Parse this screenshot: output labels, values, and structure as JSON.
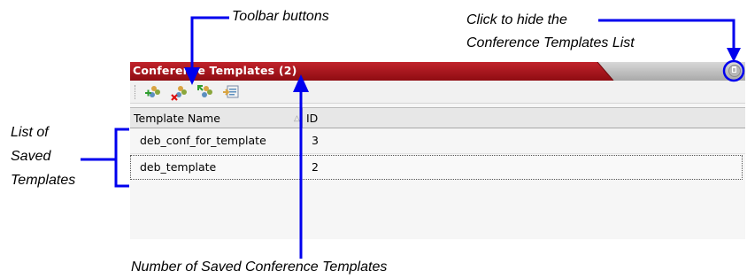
{
  "callouts": {
    "toolbar_buttons": "Toolbar buttons",
    "hide_line1": "Click to hide the",
    "hide_line2": "Conference Templates List",
    "list_line1": "List of",
    "list_line2": "Saved",
    "list_line3": "Templates",
    "number_saved": "Number of Saved Conference Templates"
  },
  "panel": {
    "title": "Conference Templates (2)",
    "title_bar_color": "#a90f17",
    "toolbar_icons": [
      "add-template-icon",
      "delete-template-icon",
      "edit-template-icon",
      "export-template-icon"
    ],
    "hide_icon": "pin-icon"
  },
  "table": {
    "columns": [
      "Template Name",
      "ID"
    ],
    "rows": [
      {
        "name": "deb_conf_for_template",
        "id": "3"
      },
      {
        "name": "deb_template",
        "id": "2"
      }
    ]
  },
  "accent_color": "#0000ee"
}
